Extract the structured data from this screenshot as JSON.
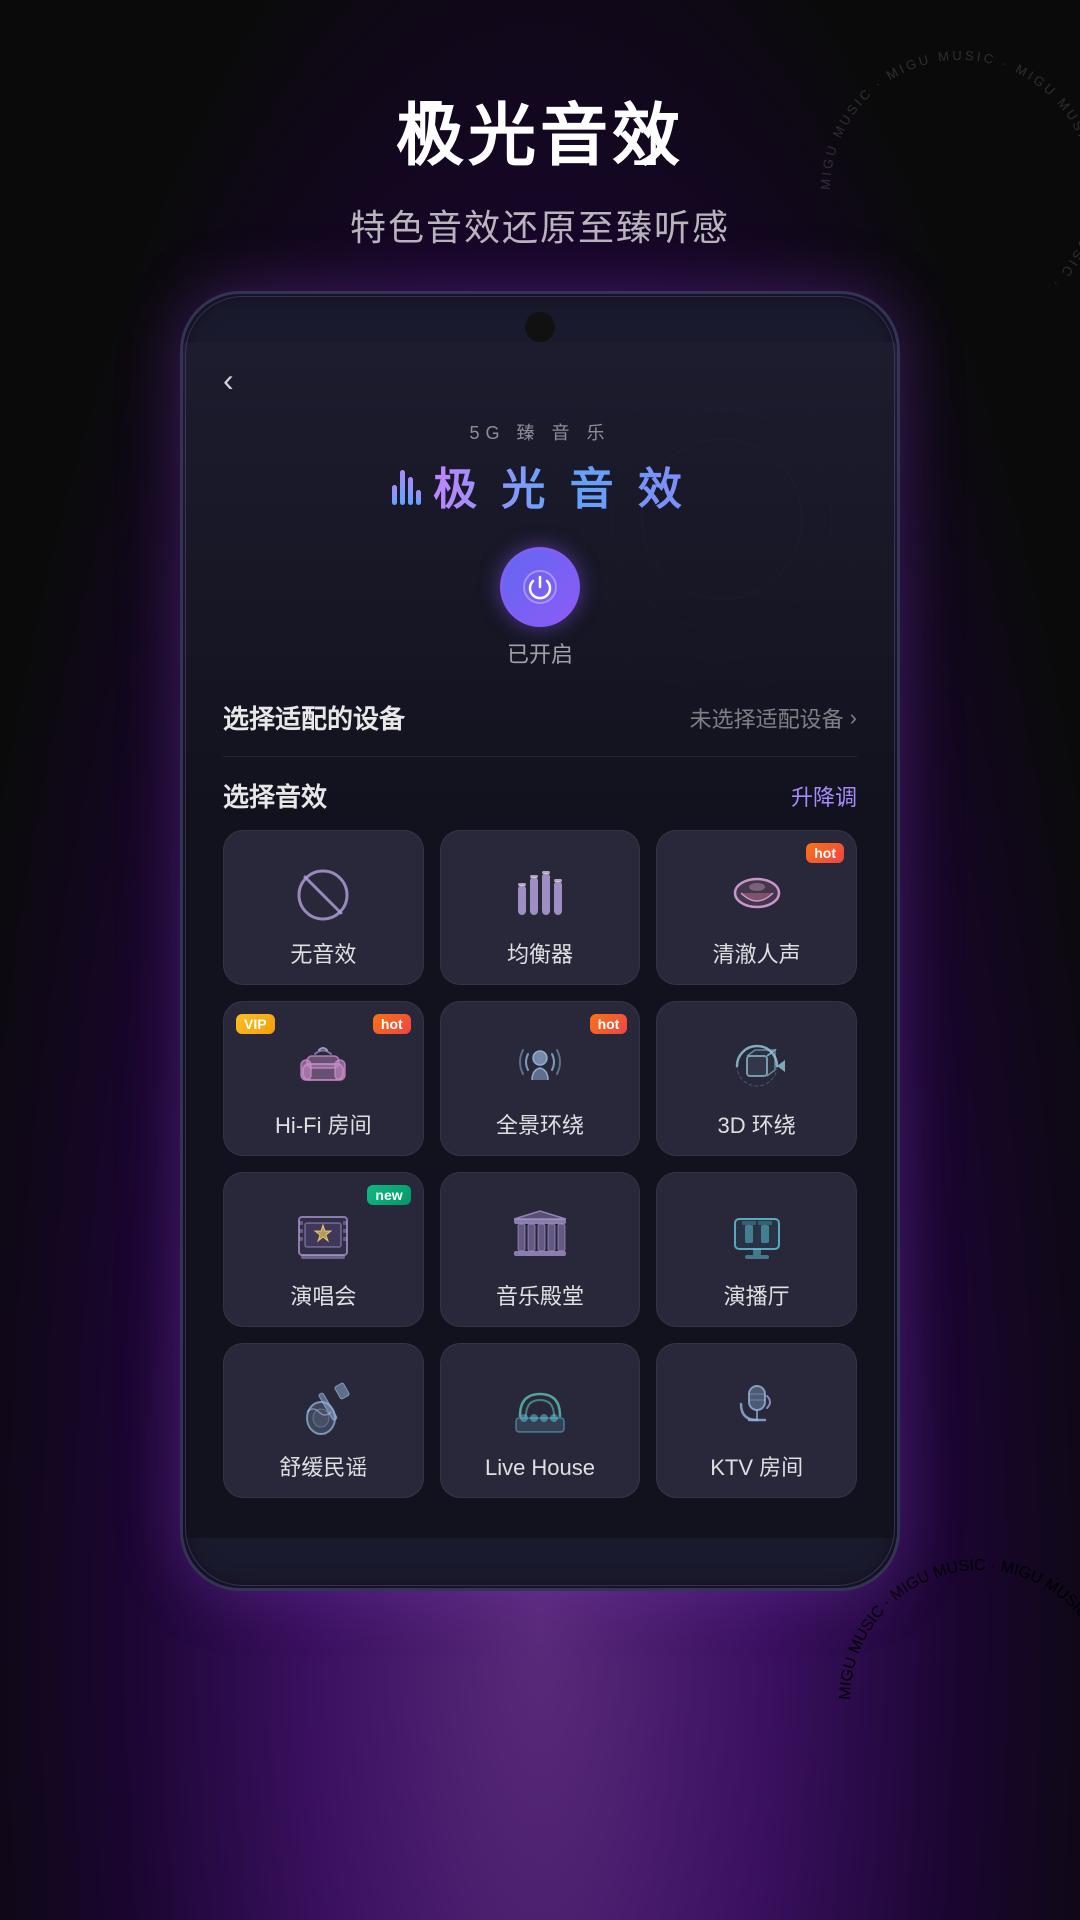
{
  "page": {
    "background": "#0a0a0a"
  },
  "header": {
    "title": "极光音效",
    "subtitle": "特色音效还原至臻听感",
    "title_prefix": "「",
    "title_suffix": "」"
  },
  "migu_watermark": "MIGU MUSIC",
  "phone": {
    "app_subtitle": "5G  臻 音 乐",
    "app_name": "极 光 音 效",
    "back_icon": "‹",
    "power_status": "已开启",
    "device_section": {
      "label": "选择适配的设备",
      "action_text": "未选择适配设备",
      "chevron": "›"
    },
    "sound_section": {
      "label": "选择音效",
      "action_text": "升降调"
    },
    "effects": [
      {
        "id": "no-effect",
        "name": "无音效",
        "icon_type": "no-sound",
        "badge": null,
        "vip": false
      },
      {
        "id": "equalizer",
        "name": "均衡器",
        "icon_type": "equalizer",
        "badge": null,
        "vip": false
      },
      {
        "id": "clear-voice",
        "name": "清澈人声",
        "icon_type": "lips",
        "badge": "hot",
        "vip": false
      },
      {
        "id": "hifi-room",
        "name": "Hi-Fi 房间",
        "icon_type": "sofa",
        "badge": "hot",
        "vip": true
      },
      {
        "id": "panoramic",
        "name": "全景环绕",
        "icon_type": "surround-person",
        "badge": "hot",
        "vip": false
      },
      {
        "id": "3d-surround",
        "name": "3D 环绕",
        "icon_type": "3d-box",
        "badge": null,
        "vip": false
      },
      {
        "id": "concert",
        "name": "演唱会",
        "icon_type": "stage",
        "badge": "new",
        "vip": false
      },
      {
        "id": "music-hall",
        "name": "音乐殿堂",
        "icon_type": "hall",
        "badge": null,
        "vip": false
      },
      {
        "id": "auditorium",
        "name": "演播厅",
        "icon_type": "broadcast",
        "badge": null,
        "vip": false
      },
      {
        "id": "folk",
        "name": "舒缓民谣",
        "icon_type": "guitar",
        "badge": null,
        "vip": false
      },
      {
        "id": "live-house",
        "name": "Live House",
        "icon_type": "live-house",
        "badge": null,
        "vip": false
      },
      {
        "id": "ktv",
        "name": "KTV 房间",
        "icon_type": "mic",
        "badge": null,
        "vip": false
      }
    ]
  }
}
